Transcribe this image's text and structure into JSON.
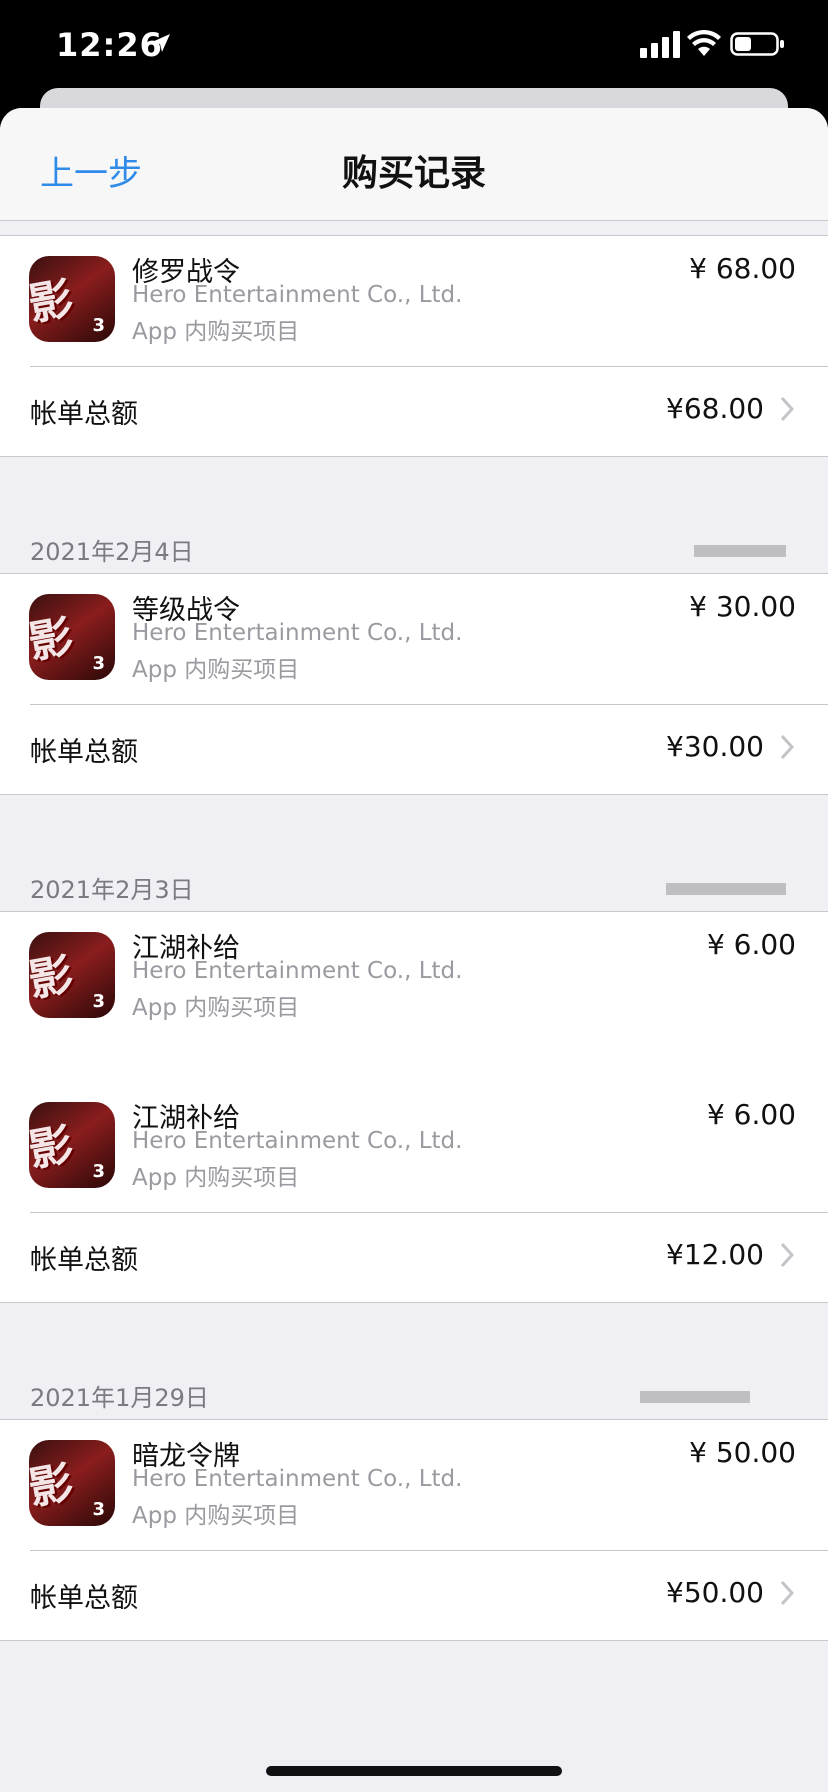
{
  "status_bar": {
    "time": "12:26"
  },
  "navbar": {
    "back_label": "上一步",
    "title": "购买记录"
  },
  "colors": {
    "accent": "#2f8ae8",
    "background": "#efeff4"
  },
  "groups": [
    {
      "date": "",
      "items": [
        {
          "name": "修罗战令",
          "developer": "Hero Entertainment Co., Ltd.",
          "type": "App 内购买项目",
          "price": "¥ 68.00"
        }
      ],
      "total_label": "帐单总额",
      "total": "¥68.00"
    },
    {
      "date": "2021年2月4日",
      "items": [
        {
          "name": "等级战令",
          "developer": "Hero Entertainment Co., Ltd.",
          "type": "App 内购买项目",
          "price": "¥ 30.00"
        }
      ],
      "total_label": "帐单总额",
      "total": "¥30.00"
    },
    {
      "date": "2021年2月3日",
      "items": [
        {
          "name": "江湖补给",
          "developer": "Hero Entertainment Co., Ltd.",
          "type": "App 内购买项目",
          "price": "¥ 6.00"
        },
        {
          "name": "江湖补给",
          "developer": "Hero Entertainment Co., Ltd.",
          "type": "App 内购买项目",
          "price": "¥ 6.00"
        }
      ],
      "total_label": "帐单总额",
      "total": "¥12.00"
    },
    {
      "date": "2021年1月29日",
      "items": [
        {
          "name": "暗龙令牌",
          "developer": "Hero Entertainment Co., Ltd.",
          "type": "App 内购买项目",
          "price": "¥ 50.00"
        }
      ],
      "total_label": "帐单总额",
      "total": "¥50.00"
    }
  ],
  "app_icon_glyph": "影之刃",
  "app_icon_num": "3"
}
